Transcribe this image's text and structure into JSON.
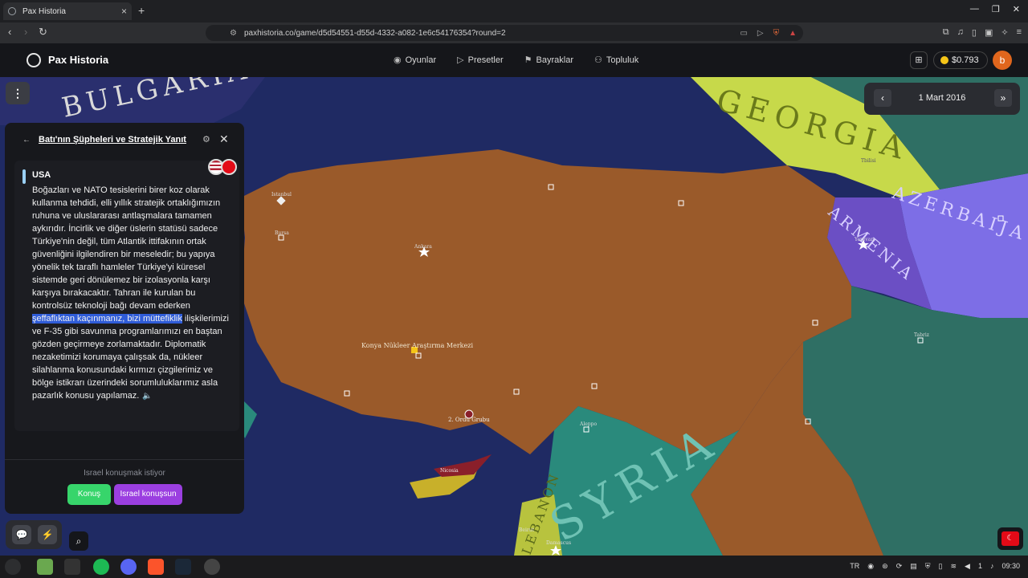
{
  "browser": {
    "tab_title": "Pax Historia",
    "url": "paxhistoria.co/game/d5d54551-d55d-4332-a082-1e6c54176354?round=2"
  },
  "header": {
    "brand": "Pax Historia",
    "nav": [
      {
        "icon": "gamepad-icon",
        "label": "Oyunlar"
      },
      {
        "icon": "play-icon",
        "label": "Presetler"
      },
      {
        "icon": "flag-icon",
        "label": "Bayraklar"
      },
      {
        "icon": "users-icon",
        "label": "Topluluk"
      }
    ],
    "balance": "$0.793",
    "avatar_letter": "b"
  },
  "date_panel": {
    "date": "1 Mart 2016"
  },
  "panel": {
    "title": "Batı'nın Şüpheleri ve Stratejik Yanıt",
    "message": {
      "sender": "USA",
      "text_before": "Boğazları ve NATO tesislerini birer koz olarak kullanma tehdidi, elli yıllık stratejik ortaklığımızın ruhuna ve uluslararası antlaşmalara tamamen aykırıdır. İncirlik ve diğer üslerin statüsü sadece Türkiye'nin değil, tüm Atlantik ittifakının ortak güvenliğini ilgilendiren bir meseledir; bu yapıya yönelik tek taraflı hamleler Türkiye'yi küresel sistemde geri dönülemez bir izolasyonla karşı karşıya bırakacaktır. Tahran ile kurulan bu kontrolsüz teknoloji bağı devam ederken ",
      "text_highlight": "şeffaflıktan kaçınmanız, bizi müttefiklik",
      "text_after": " ilişkilerimizi ve F-35 gibi savunma programlarımızı en baştan gözden geçirmeye zorlamaktadır. Diplomatik nezaketimizi korumaya çalışsak da, nükleer silahlanma konusundaki kırmızı çizgilerimiz ve bölge istikrarı üzerindeki sorumluluklarımız asla pazarlık konusu yapılamaz."
    },
    "wants_to_talk": "Israel konuşmak istiyor",
    "talk_button": "Konuş",
    "let_button": "Israel konuşsun"
  },
  "map": {
    "country_labels": [
      "BULGARIA",
      "GEORGIA",
      "ARMENIA",
      "AZERBAIJA",
      "SYRIA",
      "LEBANON"
    ],
    "city_labels": [
      "Istanbul",
      "Bursa",
      "Ankara",
      "Konya Nükleer Araştırma Merkezi",
      "2. Ordu Grubu",
      "Nicosia",
      "Yerevan",
      "Tbilisi",
      "Beirut",
      "Damascus",
      "Aleppo",
      "Tabriz"
    ],
    "colors": {
      "sea": "#1f2a63",
      "turkey": "#9a5a2a",
      "georgia": "#c7d94a",
      "armenia": "#6b4fc4",
      "azerbaijan": "#7d6ee6",
      "syria": "#2a8a7c",
      "iran": "#2f6f64",
      "lebanon": "#b8c33e",
      "cyprus": "#c8b02a",
      "bulgaria": "#2a2f6e"
    }
  },
  "taskbar": {
    "lang": "TR",
    "time": "09:30",
    "count": "1"
  }
}
